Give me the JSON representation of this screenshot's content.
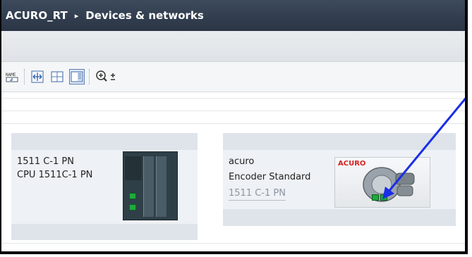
{
  "title": {
    "project": "ACURO_RT",
    "separator": "▸",
    "section": "Devices & networks"
  },
  "toolbar": {
    "items": [
      "name-icon",
      "fit-icon",
      "grid-icon",
      "view-icon",
      "zoom-icon"
    ]
  },
  "devices": [
    {
      "name": "1511 C-1 PN",
      "type": "CPU 1511C-1 PN"
    },
    {
      "name": "acuro",
      "type": "Encoder Standard",
      "link": "1511 C-1 PN",
      "logo_text": "ACURO"
    }
  ],
  "colors": {
    "arrow": "#1a2ee6",
    "port": "#1faa3c",
    "titlebar": "#2e3a4b"
  }
}
